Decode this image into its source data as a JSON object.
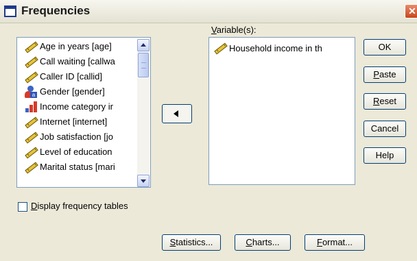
{
  "window": {
    "title": "Frequencies",
    "close_glyph": "✕"
  },
  "source_list": {
    "items": [
      {
        "label": "Age in years [age]",
        "icon": "scale-ruler-icon"
      },
      {
        "label": "Call waiting [callwa",
        "icon": "scale-ruler-icon"
      },
      {
        "label": "Caller ID [callid]",
        "icon": "scale-ruler-icon"
      },
      {
        "label": "Gender [gender]",
        "icon": "nominal-person-icon"
      },
      {
        "label": "Income category ir",
        "icon": "ordinal-bars-icon"
      },
      {
        "label": "Internet [internet]",
        "icon": "scale-ruler-icon"
      },
      {
        "label": "Job satisfaction [jo",
        "icon": "scale-ruler-icon"
      },
      {
        "label": "Level of education",
        "icon": "scale-ruler-icon"
      },
      {
        "label": "Marital status [mari",
        "icon": "scale-ruler-icon"
      }
    ]
  },
  "target": {
    "label_prefix": "",
    "label_accel": "V",
    "label_rest": "ariable(s):",
    "items": [
      {
        "label": "Household income in th",
        "icon": "scale-ruler-icon"
      }
    ]
  },
  "buttons": {
    "ok": "OK",
    "paste_accel": "P",
    "paste_rest": "aste",
    "reset_accel": "R",
    "reset_rest": "eset",
    "cancel": "Cancel",
    "help": "Help",
    "statistics_accel": "S",
    "statistics_rest": "tatistics...",
    "charts_accel": "C",
    "charts_rest": "harts...",
    "format_accel": "F",
    "format_rest": "ormat..."
  },
  "options": {
    "display_tables_accel": "D",
    "display_tables_rest": "isplay frequency tables",
    "display_tables_checked": false
  }
}
